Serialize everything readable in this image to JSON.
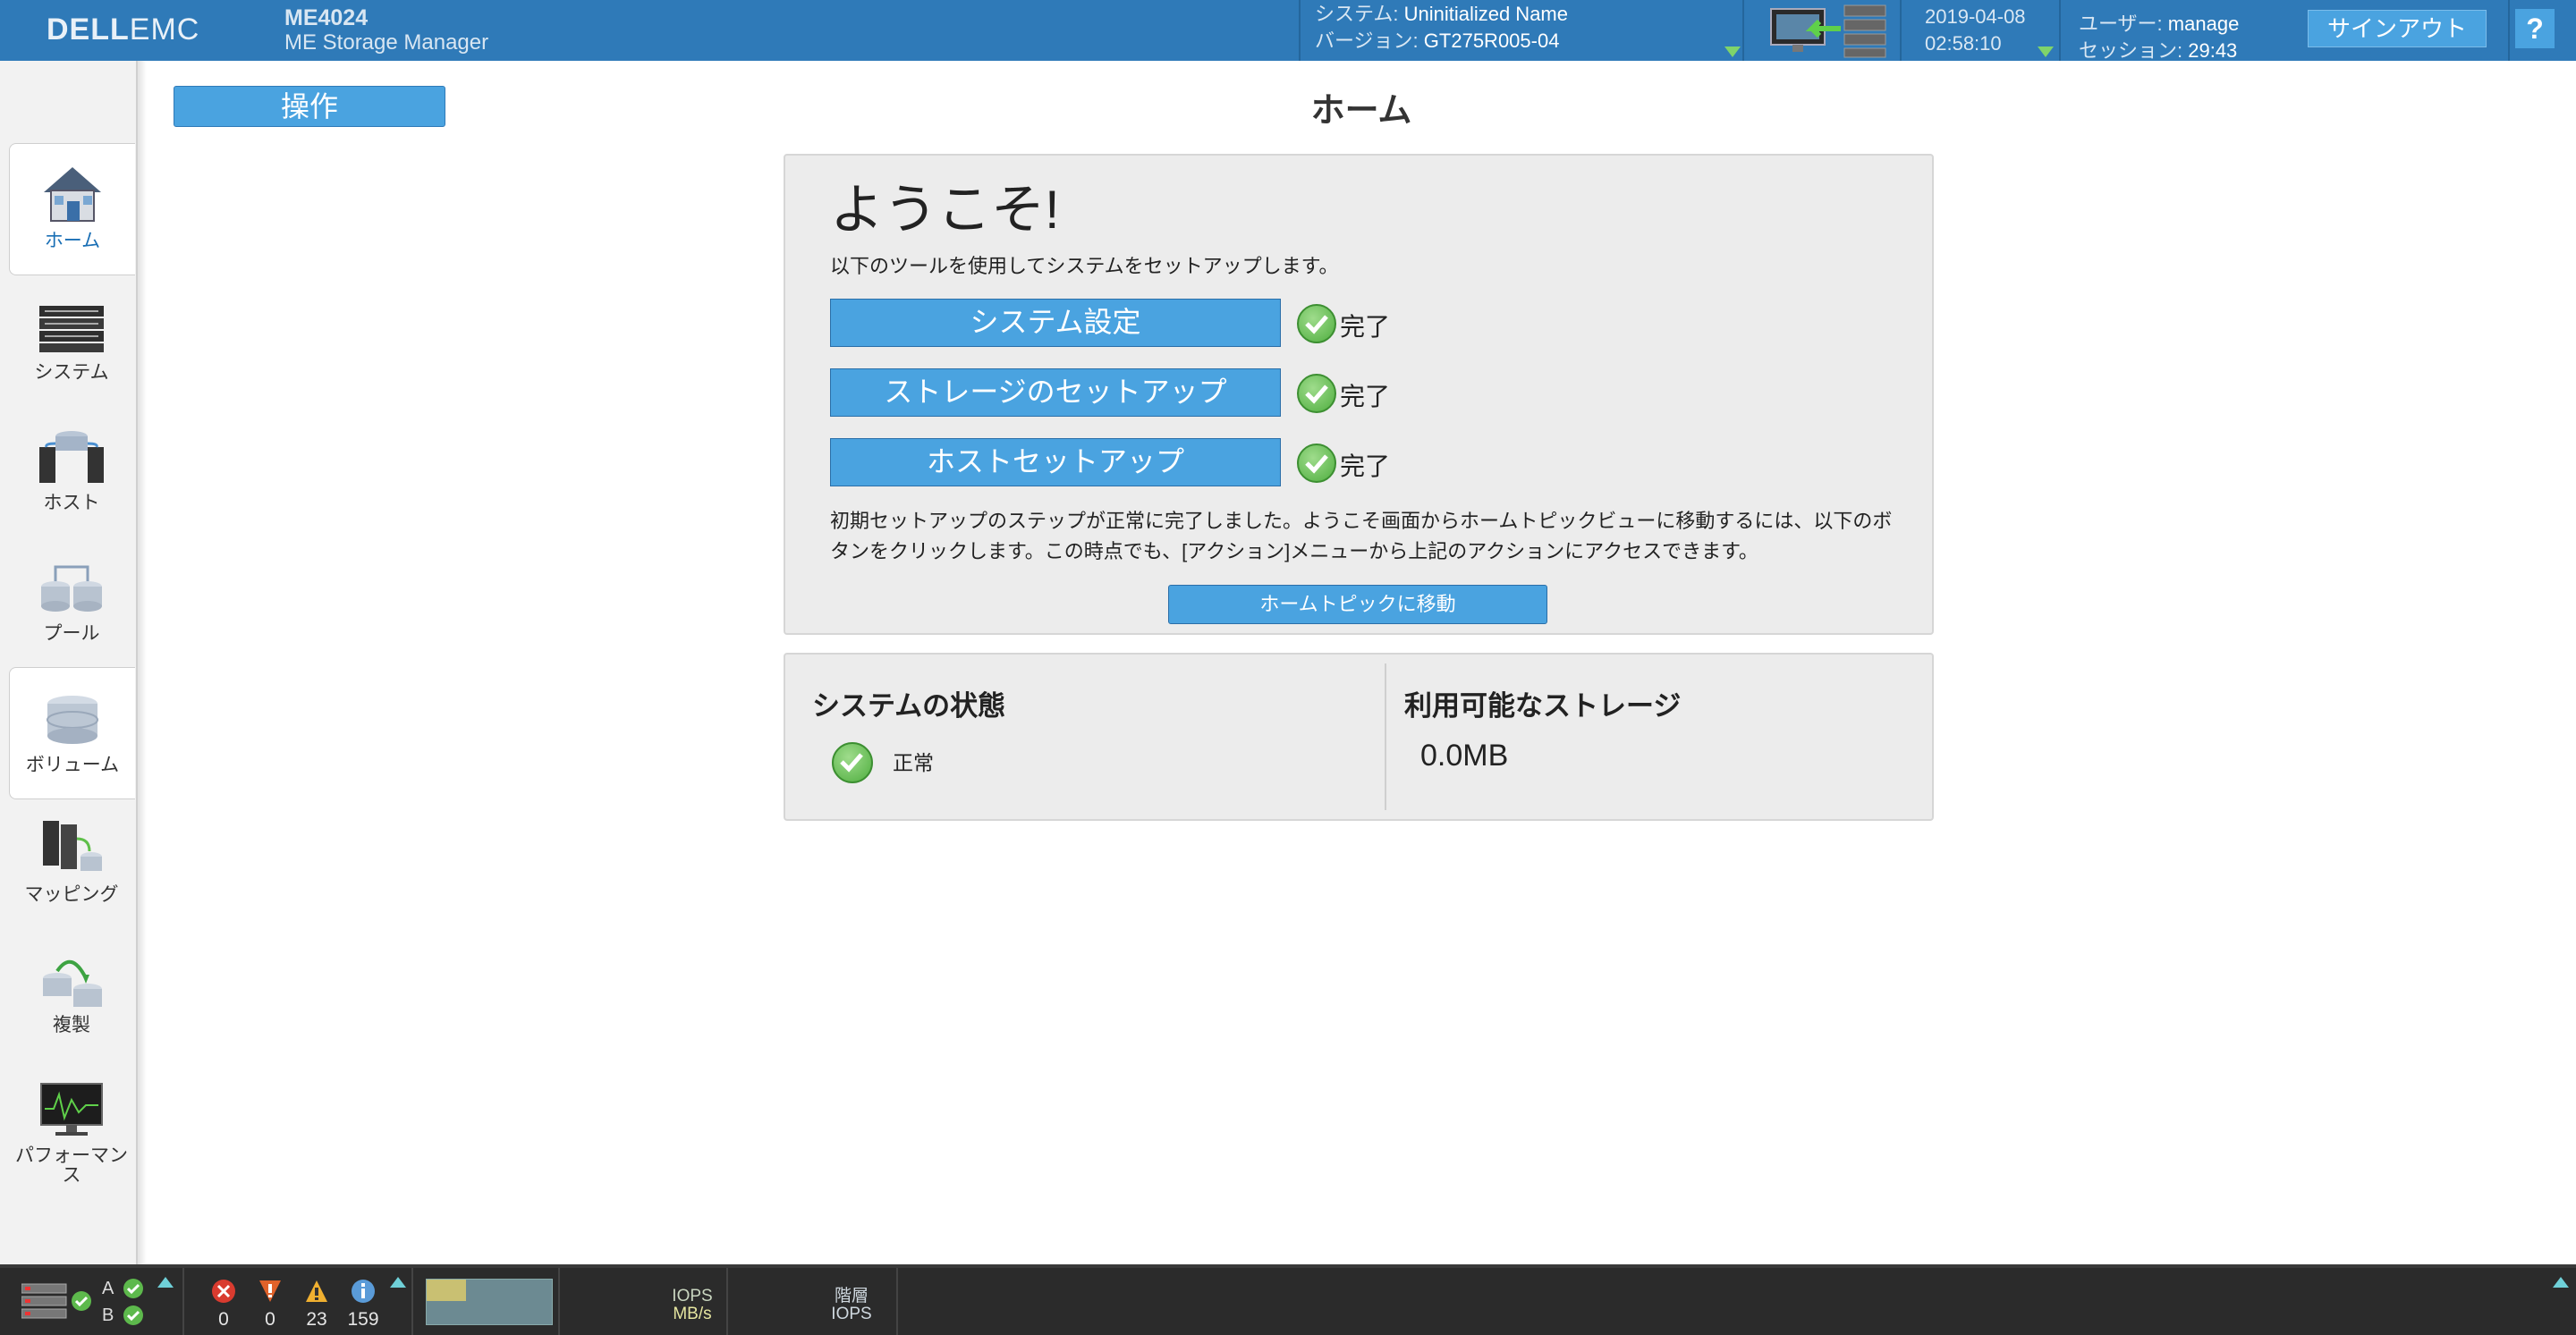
{
  "header": {
    "logo_left": "DELL",
    "logo_right": "EMC",
    "model": "ME4024",
    "product_name": "ME Storage Manager",
    "system_label": "システム: ",
    "system_value": "Uninitialized Name",
    "version_label": "バージョン: ",
    "version_value": "GT275R005-04",
    "date": "2019-04-08",
    "time": "02:58:10",
    "user_label": "ユーザー: ",
    "user_value": "manage",
    "session_label": "セッション: ",
    "session_value": "29:43",
    "signout_label": "サインアウト",
    "help_label": "?"
  },
  "sidebar": {
    "items": [
      {
        "label": "ホーム",
        "icon": "house-icon",
        "active": true
      },
      {
        "label": "システム",
        "icon": "system-enclosure-icon",
        "active": false
      },
      {
        "label": "ホスト",
        "icon": "hosts-icon",
        "active": false
      },
      {
        "label": "プール",
        "icon": "pools-icon",
        "active": false
      },
      {
        "label": "ボリューム",
        "icon": "volumes-icon",
        "active": false
      },
      {
        "label": "マッピング",
        "icon": "mapping-icon",
        "active": false
      },
      {
        "label": "複製",
        "icon": "replication-icon",
        "active": false
      },
      {
        "label": "パフォーマンス",
        "icon": "performance-monitor-icon",
        "active": false
      }
    ]
  },
  "main": {
    "operations_label": "操作",
    "page_title": "ホーム",
    "welcome": {
      "title": "ようこそ!",
      "intro": "以下のツールを使用してシステムをセットアップします。",
      "steps": [
        {
          "label": "システム設定",
          "status": "完了"
        },
        {
          "label": "ストレージのセットアップ",
          "status": "完了"
        },
        {
          "label": "ホストセットアップ",
          "status": "完了"
        }
      ],
      "description": "初期セットアップのステップが正常に完了しました。ようこそ画面からホームトピックビューに移動するには、以下のボタンをクリックします。この時点でも、[アクション]メニューから上記のアクションにアクセスできます。",
      "goto_label": "ホームトピックに移動"
    },
    "status": {
      "system_state_title": "システムの状態",
      "system_state_value": "正常",
      "storage_title": "利用可能なストレージ",
      "storage_value": "0.0MB"
    }
  },
  "footer": {
    "controller_a": "A",
    "controller_b": "B",
    "critical_count": "0",
    "error_count": "0",
    "warning_count": "23",
    "info_count": "159",
    "perf_label_1": "IOPS",
    "perf_label_2": "MB/s",
    "tier_label_1": "階層",
    "tier_label_2": "IOPS"
  },
  "colors": {
    "header_bg": "#2f7ab8",
    "button_blue": "#4aa3e0",
    "ok_green": "#5db94c",
    "footer_bg": "#2b2b2b"
  }
}
